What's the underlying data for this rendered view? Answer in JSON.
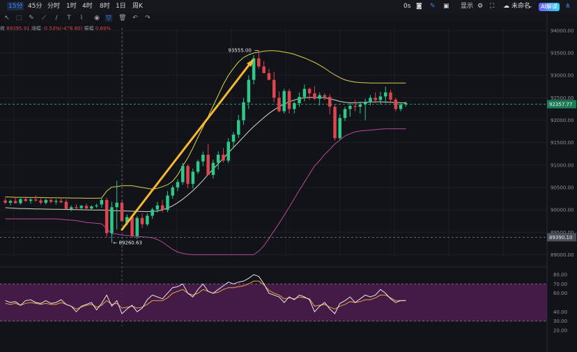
{
  "toolbar": {
    "intervals": [
      "15分",
      "45分",
      "分时",
      "1时",
      "4时",
      "8时",
      "1日",
      "周K"
    ],
    "active_interval": "15分",
    "timer": "0s",
    "display_label": "显示",
    "layout_name": "未命名",
    "ai_button": "AI解读"
  },
  "stats": {
    "prefix": "收",
    "close": "89395.91",
    "change_label": "涨幅",
    "change": "-0.53%(-476.60)",
    "amp_label": "振幅",
    "amp": "0.69%"
  },
  "colors": {
    "up": "#2ec98a",
    "down": "#e0454f",
    "bb_upper": "#d9d24a",
    "bb_mid": "#d8d8c8",
    "bb_lower": "#b8489a",
    "rsi_fill": "#4c1d4f",
    "arrow": "#f5b82e"
  },
  "chart_data": {
    "type": "candlestick",
    "y_axis_labels": [
      "94000.00",
      "93500.00",
      "93000.00",
      "92500.00",
      "92000.00",
      "91500.00",
      "91000.00",
      "90500.00",
      "90000.00",
      "89500.00",
      "89000.00"
    ],
    "ylim": [
      88960,
      94060
    ],
    "price_tag": "92357.77",
    "secondary_tag": "89390.10",
    "annotations": {
      "high": "93555.00",
      "low": "89260.63"
    },
    "candles": [
      [
        90210,
        90270,
        90130,
        90160
      ],
      [
        90160,
        90230,
        90100,
        90200
      ],
      [
        90200,
        90280,
        90140,
        90150
      ],
      [
        90150,
        90260,
        90120,
        90240
      ],
      [
        90240,
        90300,
        90180,
        90200
      ],
      [
        90200,
        90260,
        90140,
        90230
      ],
      [
        90230,
        90320,
        90190,
        90210
      ],
      [
        90210,
        90260,
        90120,
        90160
      ],
      [
        90160,
        90250,
        90120,
        90220
      ],
      [
        90220,
        90280,
        90150,
        90180
      ],
      [
        90180,
        90240,
        90120,
        90200
      ],
      [
        90200,
        90270,
        90150,
        90170
      ],
      [
        90180,
        90230,
        90000,
        90020
      ],
      [
        90020,
        90100,
        89970,
        90060
      ],
      [
        90060,
        90120,
        90000,
        90040
      ],
      [
        90040,
        90110,
        89990,
        90090
      ],
      [
        90090,
        90140,
        90020,
        90030
      ],
      [
        90030,
        90100,
        89990,
        90080
      ],
      [
        90080,
        90140,
        90040,
        90100
      ],
      [
        90120,
        90250,
        90050,
        90220
      ],
      [
        90220,
        90270,
        89400,
        89480
      ],
      [
        89480,
        90180,
        89260,
        90060
      ],
      [
        90060,
        90650,
        89560,
        90160
      ],
      [
        90160,
        90220,
        89950,
        89750
      ],
      [
        89720,
        89900,
        89660,
        89840
      ],
      [
        89840,
        89870,
        89380,
        89420
      ],
      [
        89420,
        89860,
        89350,
        89820
      ],
      [
        89820,
        89920,
        89600,
        89680
      ],
      [
        89680,
        89920,
        89640,
        89870
      ],
      [
        89870,
        90050,
        89800,
        90010
      ],
      [
        90010,
        90180,
        89940,
        90100
      ],
      [
        90100,
        90220,
        89950,
        90000
      ],
      [
        90000,
        90420,
        89950,
        90320
      ],
      [
        90320,
        90550,
        90250,
        90500
      ],
      [
        90500,
        90680,
        90420,
        90620
      ],
      [
        90620,
        91050,
        90560,
        90980
      ],
      [
        90980,
        91020,
        90480,
        90580
      ],
      [
        90580,
        90920,
        90480,
        90850
      ],
      [
        90850,
        91120,
        90800,
        91080
      ],
      [
        91080,
        91300,
        90980,
        91230
      ],
      [
        91230,
        91470,
        91100,
        90780
      ],
      [
        90780,
        91120,
        90700,
        91050
      ],
      [
        91050,
        91310,
        90900,
        91230
      ],
      [
        91230,
        91380,
        91060,
        91100
      ],
      [
        91100,
        91600,
        91050,
        91520
      ],
      [
        91520,
        91740,
        91400,
        91680
      ],
      [
        91680,
        92120,
        91600,
        92000
      ],
      [
        92000,
        92500,
        91900,
        92400
      ],
      [
        92400,
        93000,
        92250,
        92900
      ],
      [
        92900,
        93450,
        92800,
        93380
      ],
      [
        93380,
        93555,
        93150,
        93200
      ],
      [
        93200,
        93320,
        93100,
        93050
      ],
      [
        93050,
        93150,
        92950,
        92900
      ],
      [
        92900,
        93080,
        92400,
        92500
      ],
      [
        92500,
        92640,
        92180,
        92200
      ],
      [
        92200,
        92700,
        92150,
        92650
      ],
      [
        92650,
        92700,
        92150,
        92250
      ],
      [
        92250,
        92420,
        92150,
        92380
      ],
      [
        92380,
        92620,
        92300,
        92520
      ],
      [
        92520,
        92800,
        92420,
        92700
      ],
      [
        92700,
        92730,
        92450,
        92600
      ],
      [
        92600,
        92760,
        92450,
        92480
      ],
      [
        92480,
        92620,
        92330,
        92560
      ],
      [
        92560,
        92600,
        92450,
        92520
      ],
      [
        92520,
        92580,
        92130,
        92300
      ],
      [
        92300,
        92350,
        91550,
        91600
      ],
      [
        91600,
        92130,
        91560,
        92050
      ],
      [
        92050,
        92300,
        91980,
        92250
      ],
      [
        92250,
        92380,
        92080,
        92320
      ],
      [
        92320,
        92450,
        92200,
        92300
      ],
      [
        92300,
        92420,
        92150,
        92350
      ],
      [
        92350,
        92480,
        92000,
        92400
      ],
      [
        92400,
        92560,
        92330,
        92500
      ],
      [
        92500,
        92620,
        92380,
        92450
      ],
      [
        92450,
        92630,
        92350,
        92530
      ],
      [
        92530,
        92750,
        92380,
        92620
      ],
      [
        92620,
        92680,
        92400,
        92460
      ],
      [
        92460,
        92500,
        92200,
        92250
      ],
      [
        92250,
        92400,
        92200,
        92350
      ],
      [
        92350,
        92420,
        92300,
        92380
      ]
    ],
    "bb_upper": [
      90290,
      90285,
      90280,
      90280,
      90278,
      90275,
      90275,
      90275,
      90272,
      90270,
      90270,
      90268,
      90268,
      90265,
      90265,
      90262,
      90260,
      90260,
      90260,
      90265,
      90420,
      90510,
      90520,
      90540,
      90540,
      90540,
      90520,
      90500,
      90480,
      90460,
      90480,
      90520,
      90560,
      90640,
      90780,
      90980,
      91160,
      91380,
      91620,
      91850,
      92080,
      92320,
      92560,
      92800,
      93000,
      93160,
      93300,
      93400,
      93460,
      93500,
      93520,
      93540,
      93550,
      93550,
      93540,
      93520,
      93500,
      93470,
      93430,
      93390,
      93340,
      93290,
      93230,
      93160,
      93080,
      93010,
      92950,
      92900,
      92870,
      92850,
      92840,
      92835,
      92830,
      92830,
      92830,
      92830,
      92830,
      92830,
      92830,
      92830
    ],
    "bb_mid": [
      90050,
      90040,
      90035,
      90030,
      90028,
      90025,
      90022,
      90020,
      90018,
      90015,
      90013,
      90012,
      90010,
      90008,
      90005,
      90003,
      90000,
      89998,
      89996,
      89998,
      89990,
      89985,
      89980,
      89978,
      89975,
      89970,
      89968,
      89965,
      89962,
      89965,
      89975,
      90000,
      90040,
      90090,
      90160,
      90240,
      90330,
      90430,
      90540,
      90660,
      90790,
      90910,
      91030,
      91150,
      91270,
      91390,
      91510,
      91630,
      91750,
      91860,
      91960,
      92060,
      92150,
      92230,
      92300,
      92360,
      92410,
      92450,
      92480,
      92500,
      92510,
      92510,
      92505,
      92500,
      92480,
      92450,
      92420,
      92400,
      92390,
      92390,
      92395,
      92400,
      92405,
      92410,
      92410,
      92405,
      92400,
      92395,
      92390,
      92388
    ],
    "bb_lower": [
      89800,
      89800,
      89800,
      89800,
      89800,
      89800,
      89800,
      89800,
      89800,
      89800,
      89800,
      89790,
      89780,
      89770,
      89760,
      89740,
      89720,
      89710,
      89700,
      89690,
      89580,
      89470,
      89460,
      89440,
      89430,
      89420,
      89410,
      89400,
      89390,
      89380,
      89340,
      89280,
      89200,
      89120,
      89060,
      89030,
      89010,
      89000,
      89000,
      89000,
      89000,
      89000,
      89000,
      89000,
      89000,
      89000,
      89000,
      89000,
      89000,
      89000,
      89080,
      89200,
      89360,
      89530,
      89700,
      89880,
      90060,
      90250,
      90440,
      90620,
      90800,
      90980,
      91100,
      91240,
      91350,
      91470,
      91560,
      91650,
      91700,
      91740,
      91760,
      91770,
      91780,
      91790,
      91800,
      91810,
      91810,
      91810,
      91810,
      91810
    ],
    "rsi": {
      "y_axis_labels": [
        "80.00",
        "70.00",
        "60.00",
        "40.00",
        "30.00",
        "20.00"
      ],
      "upper_band": 70,
      "lower_band": 30,
      "line1": [
        52,
        50,
        51,
        47,
        52,
        53,
        50,
        49,
        52,
        49,
        50,
        53,
        48,
        46,
        40,
        46,
        48,
        50,
        42,
        49,
        58,
        46,
        52,
        38,
        43,
        47,
        40,
        44,
        53,
        58,
        56,
        54,
        60,
        66,
        67,
        70,
        60,
        56,
        64,
        70,
        62,
        60,
        64,
        68,
        72,
        70,
        72,
        73,
        76,
        80,
        78,
        70,
        60,
        58,
        56,
        50,
        56,
        53,
        58,
        56,
        53,
        40,
        46,
        50,
        43,
        38,
        49,
        52,
        56,
        50,
        54,
        58,
        56,
        58,
        64,
        60,
        54,
        50,
        52,
        52
      ],
      "line2": [
        49,
        48,
        49,
        47,
        49,
        50,
        49,
        48,
        49,
        48,
        48,
        50,
        48,
        46,
        43,
        45,
        47,
        48,
        45,
        47,
        52,
        48,
        49,
        44,
        45,
        46,
        44,
        45,
        48,
        52,
        52,
        52,
        55,
        60,
        62,
        64,
        60,
        58,
        60,
        64,
        62,
        60,
        61,
        64,
        66,
        66,
        67,
        68,
        70,
        73,
        73,
        69,
        63,
        60,
        58,
        54,
        55,
        54,
        56,
        55,
        54,
        46,
        47,
        48,
        45,
        43,
        46,
        48,
        51,
        50,
        51,
        53,
        53,
        55,
        58,
        58,
        55,
        52,
        52,
        52
      ]
    }
  }
}
